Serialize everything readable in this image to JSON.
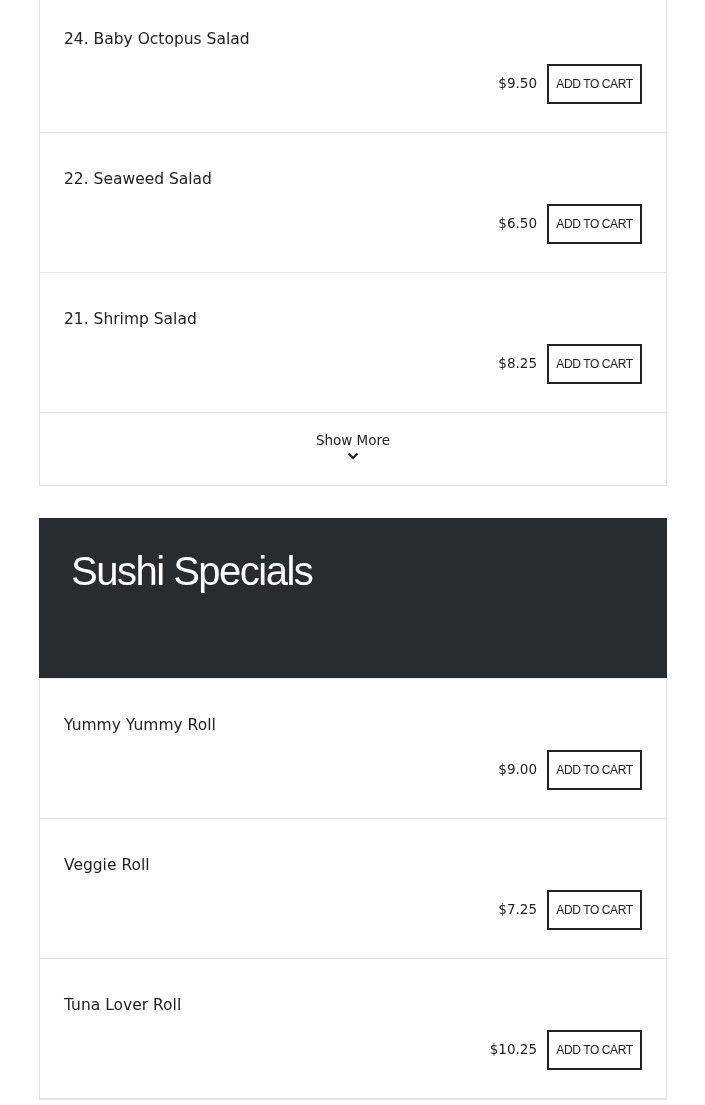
{
  "sections": [
    {
      "items": [
        {
          "name": "24. Baby Octopus Salad",
          "price": "$9.50",
          "button": "ADD TO CART"
        },
        {
          "name": "22. Seaweed Salad",
          "price": "$6.50",
          "button": "ADD TO CART"
        },
        {
          "name": "21. Shrimp Salad",
          "price": "$8.25",
          "button": "ADD TO CART"
        }
      ],
      "show_more": "Show More"
    },
    {
      "title": "Sushi Specials",
      "items": [
        {
          "name": "Yummy Yummy Roll",
          "price": "$9.00",
          "button": "ADD TO CART"
        },
        {
          "name": "Veggie Roll",
          "price": "$7.25",
          "button": "ADD TO CART"
        },
        {
          "name": "Tuna Lover Roll",
          "price": "$10.25",
          "button": "ADD TO CART"
        }
      ]
    }
  ]
}
